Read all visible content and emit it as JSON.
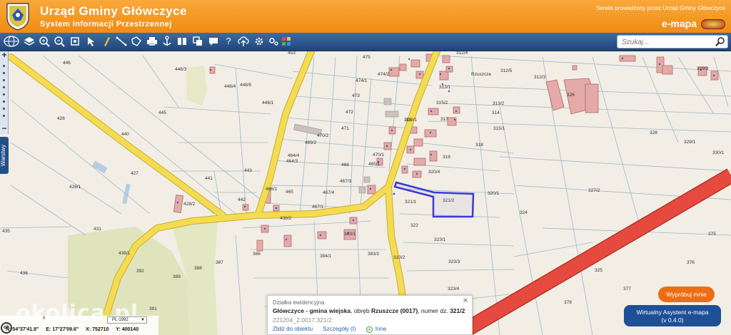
{
  "header": {
    "title": "Urząd Gminy Główczyce",
    "subtitle": "System Informacji Przestrzennej",
    "service_text": "Serwis prowadzony przez Urząd Gminy Główczyce",
    "logo_text": "e-mapa",
    "crest_icon": "coat-of-arms-icon"
  },
  "toolbar": {
    "icons": [
      "globe-icon",
      "layers-icon",
      "zoom-in-icon",
      "zoom-out-icon",
      "full-extent-icon",
      "select-arrow-icon",
      "info-pencil-icon",
      "measure-line-icon",
      "measure-area-icon",
      "print-icon",
      "anchor-icon",
      "split-view-icon",
      "overlay-icon",
      "comment-icon",
      "help-icon",
      "upload-icon",
      "settings-icon",
      "plugin-icon",
      "legend-icon"
    ],
    "search_placeholder": "Szukaj..."
  },
  "left_panel": {
    "zoom_in": "+",
    "zoom_out": "−",
    "layers_tab_label": "Warstwy"
  },
  "map": {
    "place_name": "Rzuszcze",
    "road_number": "835",
    "highlighted_parcel": "321/2",
    "parcel_labels": [
      "446",
      "448/3",
      "448/4",
      "448/5",
      "445",
      "448/1",
      "426",
      "440",
      "427",
      "428/1",
      "428/2",
      "441",
      "443",
      "442",
      "435",
      "431",
      "436",
      "438/1",
      "392",
      "389",
      "388",
      "387",
      "386",
      "391",
      "453",
      "475",
      "474/2",
      "474/1",
      "473",
      "472",
      "471",
      "470/2",
      "469/2",
      "470/1",
      "465/1",
      "464/4",
      "464/3",
      "468",
      "467/3",
      "467/4",
      "466/1",
      "465",
      "467/1",
      "438/2",
      "383/1",
      "384/1",
      "383/2",
      "310/2",
      "322",
      "321/1",
      "321/2",
      "323/1",
      "323/3",
      "323/4",
      "320/4",
      "319",
      "320/1",
      "318",
      "317",
      "316",
      "315/2",
      "315/1",
      "314",
      "313/2",
      "313/1",
      "312/4",
      "312/5",
      "312/3",
      "326",
      "328",
      "329/1",
      "329/3",
      "327/2",
      "330/1",
      "324",
      "325",
      "375",
      "376",
      "377",
      "378",
      "310/1"
    ]
  },
  "info_popup": {
    "title": "Działka ewidencyjna",
    "gmina": "Główczyce - gmina wiejska",
    "obreb_prefix": ", obręb ",
    "obreb": "Rzuszcze (0017)",
    "numer_prefix": ", numer dz. ",
    "numer": "321/2",
    "code": "221204_2.0017.321/2",
    "link_zoom": "Zbliż do obiektu",
    "link_details": "Szczegóły (I)",
    "link_other": "Inne"
  },
  "assistant": {
    "try_label": "Wypróbuj mnie",
    "name": "Wirtualny Asystent e-mapa",
    "version": "(v 0.4.0)"
  },
  "statusbar": {
    "ok_label": "ok",
    "scale_text": "0",
    "crs": "PL-1992",
    "n": "N: 54°37'41.8\"",
    "e": "E: 17°27'09.6\"",
    "x": "X: 752710",
    "y": "Y: 400140"
  },
  "watermark": "okolica.pl",
  "colors": {
    "header_orange": "#f39a22",
    "toolbar_blue": "#2c5894",
    "road_yellow": "#f2d84a",
    "main_road_red": "#e64a3e",
    "parcel_highlight": "#3a3ad4",
    "building_fill": "#e2aaa9"
  }
}
